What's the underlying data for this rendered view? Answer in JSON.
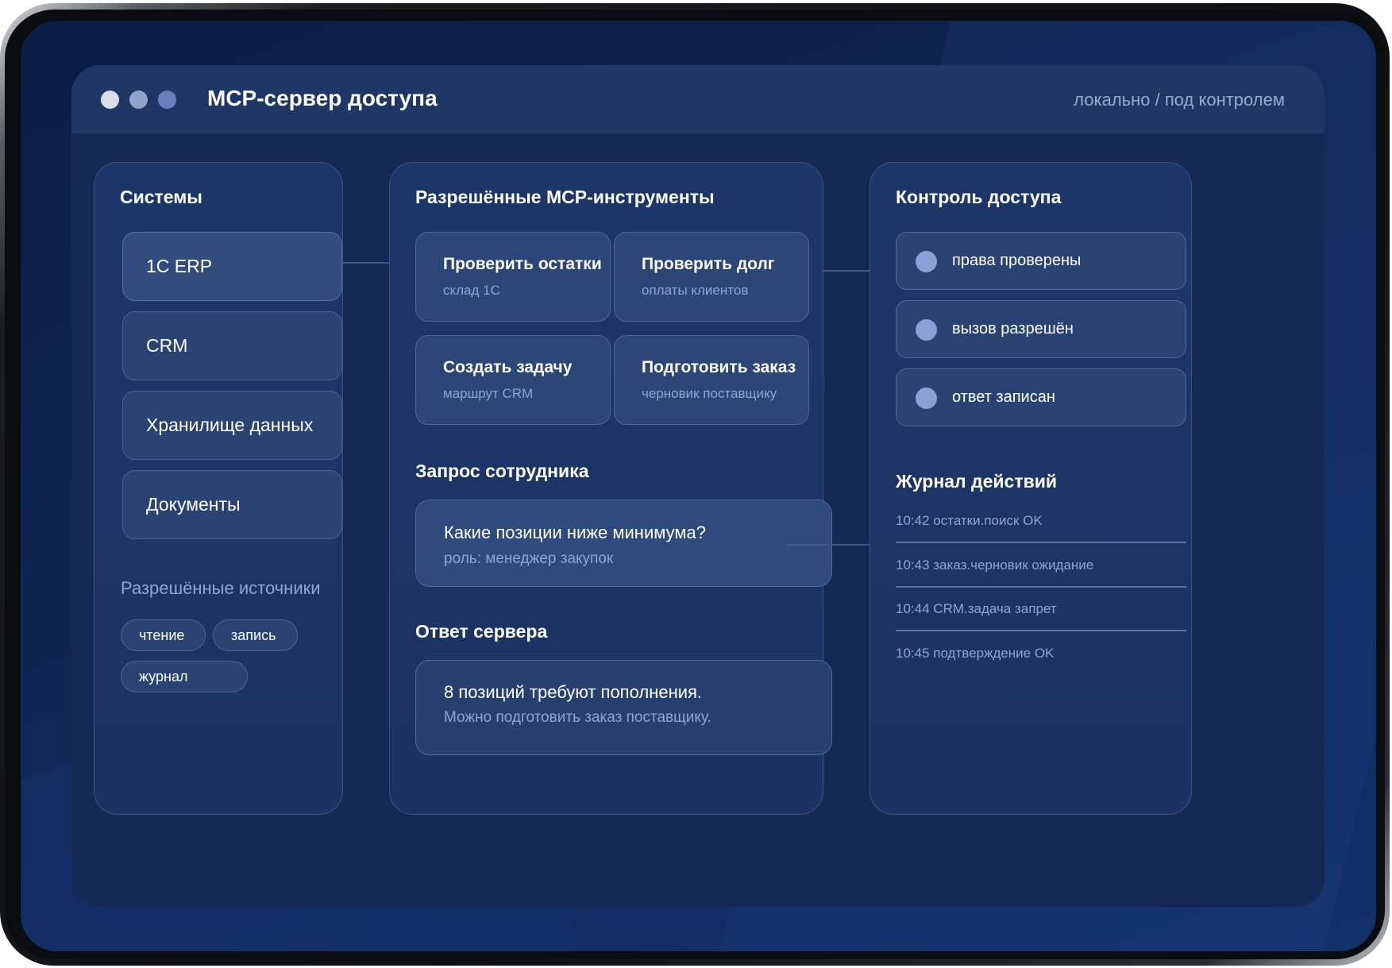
{
  "window": {
    "title": "MCP-сервер доступа",
    "status": "локально / под контролем"
  },
  "systems": {
    "title": "Системы",
    "items": [
      {
        "label": "1C ERP"
      },
      {
        "label": "CRM"
      },
      {
        "label": "Хранилище данных"
      },
      {
        "label": "Документы"
      }
    ],
    "sources_label": "Разрешённые источники",
    "chips": [
      {
        "label": "чтение"
      },
      {
        "label": "запись"
      },
      {
        "label": "журнал"
      }
    ]
  },
  "tools": {
    "title": "Разрешённые MCP-инструменты",
    "items": [
      {
        "name": "Проверить остатки",
        "sub": "склад 1С"
      },
      {
        "name": "Проверить долг",
        "sub": "оплаты клиентов"
      },
      {
        "name": "Создать задачу",
        "sub": "маршрут CRM"
      },
      {
        "name": "Подготовить заказ",
        "sub": "черновик поставщику"
      }
    ]
  },
  "request": {
    "title": "Запрос сотрудника",
    "text": "Какие позиции ниже минимума?",
    "role": "роль: менеджер закупок"
  },
  "response": {
    "title": "Ответ сервера",
    "text": "8 позиций требуют пополнения.",
    "hint": "Можно подготовить заказ поставщику."
  },
  "access": {
    "title": "Контроль доступа",
    "checks": [
      {
        "label": "права проверены"
      },
      {
        "label": "вызов разрешён"
      },
      {
        "label": "ответ записан"
      }
    ]
  },
  "log": {
    "title": "Журнал действий",
    "entries": [
      "10:42 остатки.поиск OK",
      "10:43 заказ.черновик ожидание",
      "10:44 CRM.задача запрет",
      "10:45 подтверждение OK"
    ]
  },
  "colors": {
    "background": "#0f2553",
    "panel": "#1d366a",
    "accent": "#8aa0d6",
    "muted_text": "#8ea4d3"
  }
}
